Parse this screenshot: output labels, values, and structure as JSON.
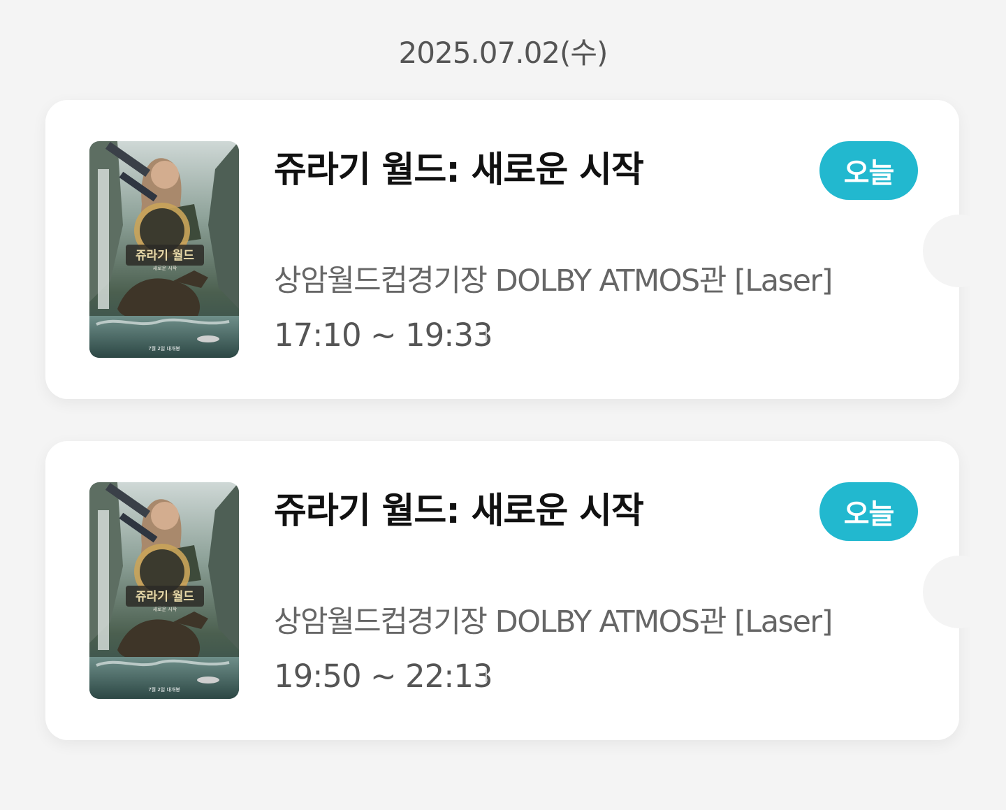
{
  "date_header": "2025.07.02(수)",
  "tickets": [
    {
      "title": "쥬라기 월드: 새로운 시작",
      "badge": "오늘",
      "theater": "상암월드컵경기장 DOLBY ATMOS관 [Laser]",
      "time": "17:10 ~ 19:33",
      "poster": {
        "title_text": "쥬라기 월드",
        "subtitle_text": "새로운 시작",
        "release_text": "7월 2일 대개봉"
      }
    },
    {
      "title": "쥬라기 월드: 새로운 시작",
      "badge": "오늘",
      "theater": "상암월드컵경기장 DOLBY ATMOS관 [Laser]",
      "time": "19:50 ~ 22:13",
      "poster": {
        "title_text": "쥬라기 월드",
        "subtitle_text": "새로운 시작",
        "release_text": "7월 2일 대개봉"
      }
    }
  ],
  "colors": {
    "background": "#f4f4f4",
    "card": "#ffffff",
    "badge": "#22b8cf",
    "title_text": "#111111",
    "sub_text": "#666666"
  }
}
